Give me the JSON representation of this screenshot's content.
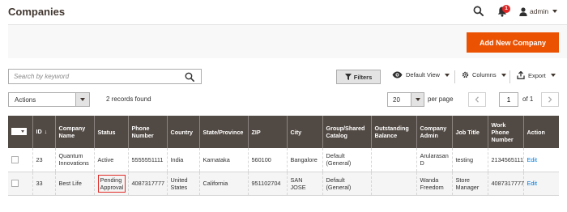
{
  "header": {
    "title": "Companies",
    "notification_count": "1",
    "user_name": "admin"
  },
  "toolbar": {
    "add_label": "Add New Company",
    "search_placeholder": "Search by keyword",
    "filters_label": "Filters",
    "view_label": "Default View",
    "columns_label": "Columns",
    "export_label": "Export",
    "actions_label": "Actions",
    "records_found": "2 records found",
    "per_page_value": "20",
    "per_page_label": "per page",
    "page_current": "1",
    "page_of": "of 1"
  },
  "colors": {
    "accent": "#eb5202",
    "header_bg": "#514943",
    "link": "#007bdb",
    "badge": "#e22626",
    "highlight_border": "#e02b27"
  },
  "icons": {
    "search": "search-icon",
    "bell": "bell-icon",
    "user": "user-icon",
    "filter": "filter-icon",
    "eye": "eye-icon",
    "gear": "gear-icon",
    "export": "export-icon"
  },
  "table": {
    "columns": [
      "ID",
      "Company Name",
      "Status",
      "Phone Number",
      "Country",
      "State/Province",
      "ZIP",
      "City",
      "Group/Shared Catalog",
      "Outstanding Balance",
      "Company Admin",
      "Job Title",
      "Work Phone Number",
      "Action"
    ],
    "rows": [
      {
        "id": "23",
        "company_name": "Quantum Innovations",
        "status": "Active",
        "phone": "5555551111",
        "country": "India",
        "state": "Karnataka",
        "zip": "560100",
        "city": "Bangalore",
        "group": "Default (General)",
        "balance": "",
        "admin": "Arularasan D",
        "job_title": "testing",
        "work_phone": "2134565111",
        "action": "Edit"
      },
      {
        "id": "33",
        "company_name": "Best Life",
        "status": "Pending Approval",
        "phone": "4087317777",
        "country": "United States",
        "state": "California",
        "zip": "951102704",
        "city": "SAN JOSE",
        "group": "Default (General)",
        "balance": "",
        "admin": "Wanda Freedom",
        "job_title": "Store Manager",
        "work_phone": "4087317777",
        "action": "Edit"
      }
    ]
  }
}
